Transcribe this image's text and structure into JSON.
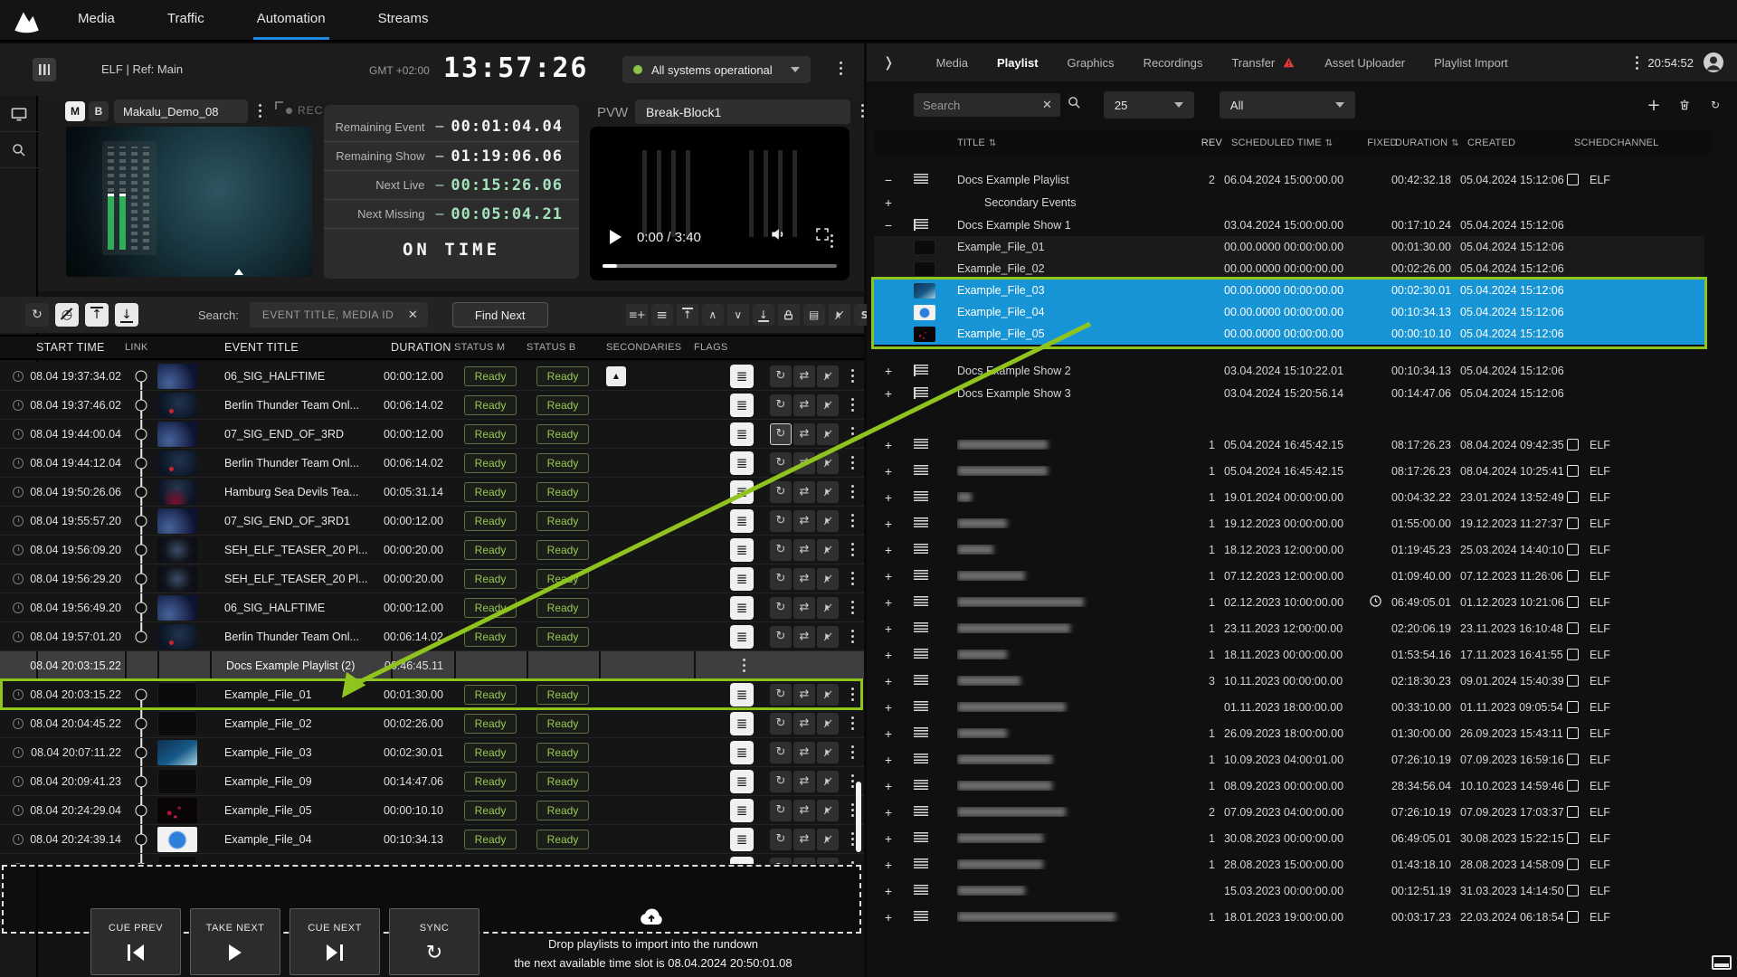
{
  "top_nav": {
    "tabs": [
      "Media",
      "Traffic",
      "Automation",
      "Streams"
    ],
    "active_tab": "Automation"
  },
  "automation": {
    "window_title": "ELF | Ref: Main",
    "gmt": "GMT +02:00",
    "clock": "13:57:26",
    "status": "All systems operational",
    "bus_a": "M",
    "bus_b": "B",
    "channel": "Makalu_Demo_08",
    "rec": "REC",
    "countdowns": [
      {
        "label": "Remaining Event",
        "dash": "–",
        "value": "00:01:04.04",
        "green": false
      },
      {
        "label": "Remaining Show",
        "dash": "–",
        "value": "01:19:06.06",
        "green": false
      },
      {
        "label": "Next Live",
        "dash": "–",
        "value": "00:15:26.06",
        "green": true
      },
      {
        "label": "Next Missing",
        "dash": "–",
        "value": "00:05:04.21",
        "green": true
      }
    ],
    "on_time": "ON TIME",
    "pvw_label": "PVW",
    "pvw_value": "Break-Block1",
    "player_time": "0:00 / 3:40",
    "search_label": "Search:",
    "search_placeholder": "EVENT TITLE, MEDIA ID",
    "find_next": "Find Next",
    "columns": {
      "start": "START TIME",
      "link": "LINK",
      "title": "EVENT TITLE",
      "dur": "DURATION",
      "m": "STATUS M",
      "b": "STATUS B",
      "sec": "SECONDARIES",
      "flags": "FLAGS"
    },
    "rows": [
      {
        "start": "08.04 19:37:34.02",
        "title": "06_SIG_HALFTIME",
        "dur": "00:00:12.00",
        "m": "Ready",
        "b": "Ready",
        "thumb": "planet",
        "link": "start",
        "sec": true
      },
      {
        "start": "08.04 19:37:46.02",
        "title": "Berlin Thunder Team Onl...",
        "dur": "00:06:14.02",
        "m": "Ready",
        "b": "Ready",
        "thumb": "thunder",
        "link": "mid"
      },
      {
        "start": "08.04 19:44:00.04",
        "title": "07_SIG_END_OF_3RD",
        "dur": "00:00:12.00",
        "m": "Ready",
        "b": "Ready",
        "thumb": "planet",
        "link": "mid",
        "flag1": true
      },
      {
        "start": "08.04 19:44:12.04",
        "title": "Berlin Thunder Team Onl...",
        "dur": "00:06:14.02",
        "m": "Ready",
        "b": "Ready",
        "thumb": "thunder",
        "link": "mid"
      },
      {
        "start": "08.04 19:50:26.06",
        "title": "Hamburg Sea Devils Tea...",
        "dur": "00:05:31.14",
        "m": "Ready",
        "b": "Ready",
        "thumb": "devils",
        "link": "mid"
      },
      {
        "start": "08.04 19:55:57.20",
        "title": "07_SIG_END_OF_3RD1",
        "dur": "00:00:12.00",
        "m": "Ready",
        "b": "Ready",
        "thumb": "planet",
        "link": "mid"
      },
      {
        "start": "08.04 19:56:09.20",
        "title": "SEH_ELF_TEASER_20 Pl...",
        "dur": "00:00:20.00",
        "m": "Ready",
        "b": "Ready",
        "thumb": "teaser",
        "link": "mid"
      },
      {
        "start": "08.04 19:56:29.20",
        "title": "SEH_ELF_TEASER_20 Pl...",
        "dur": "00:00:20.00",
        "m": "Ready",
        "b": "Ready",
        "thumb": "teaser",
        "link": "mid"
      },
      {
        "start": "08.04 19:56:49.20",
        "title": "06_SIG_HALFTIME",
        "dur": "00:00:12.00",
        "m": "Ready",
        "b": "Ready",
        "thumb": "planet",
        "link": "mid"
      },
      {
        "start": "08.04 19:57:01.20",
        "title": "Berlin Thunder Team Onl...",
        "dur": "00:06:14.02",
        "m": "Ready",
        "b": "Ready",
        "thumb": "thunder",
        "link": "end"
      },
      {
        "group": true,
        "start": "08.04 20:03:15.22",
        "title": "Docs Example Playlist (2)",
        "dur": "00:46:45.11",
        "link": "none"
      },
      {
        "start": "08.04 20:03:15.22",
        "title": "Example_File_01",
        "dur": "00:01:30.00",
        "m": "Ready",
        "b": "Ready",
        "thumb": "black",
        "link": "start",
        "outlined": true
      },
      {
        "start": "08.04 20:04:45.22",
        "title": "Example_File_02",
        "dur": "00:02:26.00",
        "m": "Ready",
        "b": "Ready",
        "thumb": "black",
        "link": "mid"
      },
      {
        "start": "08.04 20:07:11.22",
        "title": "Example_File_03",
        "dur": "00:02:30.01",
        "m": "Ready",
        "b": "Ready",
        "thumb": "earth",
        "link": "mid"
      },
      {
        "start": "08.04 20:09:41.23",
        "title": "Example_File_09",
        "dur": "00:14:47.06",
        "m": "Ready",
        "b": "Ready",
        "thumb": "black",
        "link": "mid"
      },
      {
        "start": "08.04 20:24:29.04",
        "title": "Example_File_05",
        "dur": "00:00:10.10",
        "m": "Ready",
        "b": "Ready",
        "thumb": "specks",
        "link": "mid"
      },
      {
        "start": "08.04 20:24:39.14",
        "title": "Example_File_04",
        "dur": "00:10:34.13",
        "m": "Ready",
        "b": "Ready",
        "thumb": "bunny",
        "link": "mid"
      },
      {
        "start": "",
        "title": "",
        "dur": "",
        "m": "",
        "b": "",
        "thumb": "black",
        "link": "mid",
        "partial": true
      }
    ],
    "transport": [
      {
        "label": "CUE PREV",
        "icon": "prev"
      },
      {
        "label": "TAKE NEXT",
        "icon": "play"
      },
      {
        "label": "CUE NEXT",
        "icon": "next"
      },
      {
        "label": "SYNC",
        "icon": "sync"
      }
    ],
    "dropzone": {
      "line1": "Drop playlists to import into the rundown",
      "line2": "the next available time slot is 08.04.2024 20:50:01.08"
    }
  },
  "playlist": {
    "tabs": [
      "Media",
      "Playlist",
      "Graphics",
      "Recordings",
      "Transfer",
      "Asset Uploader",
      "Playlist Import"
    ],
    "active_tab": "Playlist",
    "time": "20:54:52",
    "search_placeholder": "Search",
    "page_size": "25",
    "filter": "All",
    "columns": {
      "title": "TITLE",
      "rev": "REV",
      "sched": "SCHEDULED TIME",
      "fixed": "FIXED",
      "dur": "DURATION",
      "created": "CREATED",
      "channel": "SCHEDCHANNEL"
    },
    "tree": [
      {
        "exp": "−",
        "icon": "playlist",
        "title": "Docs Example Playlist",
        "rev": "2",
        "sched": "06.04.2024 15:00:00.00",
        "dur": "00:42:32.18",
        "created": "05.04.2024 15:12:06",
        "checkbox": true,
        "channel": "ELF"
      },
      {
        "exp": "+",
        "title": "Secondary Events",
        "indent": true
      },
      {
        "exp": "−",
        "icon": "show",
        "title": "Docs Example Show 1",
        "sched": "03.04.2024 15:00:00.00",
        "dur": "00:17:10.24",
        "created": "05.04.2024 15:12:06"
      },
      {
        "thumb": "black",
        "title": "Example_File_01",
        "sched": "00.00.0000 00:00:00.00",
        "dur": "00:01:30.00",
        "created": "05.04.2024 15:12:06",
        "child": true
      },
      {
        "thumb": "black",
        "title": "Example_File_02",
        "sched": "00.00.0000 00:00:00.00",
        "dur": "00:02:26.00",
        "created": "05.04.2024 15:12:06",
        "child": true
      },
      {
        "thumb": "earth",
        "title": "Example_File_03",
        "sched": "00.00.0000 00:00:00.00",
        "dur": "00:02:30.01",
        "created": "05.04.2024 15:12:06",
        "child": true,
        "selected": true
      },
      {
        "thumb": "bunny",
        "title": "Example_File_04",
        "sched": "00.00.0000 00:00:00.00",
        "dur": "00:10:34.13",
        "created": "05.04.2024 15:12:06",
        "child": true,
        "selected": true
      },
      {
        "thumb": "specks",
        "title": "Example_File_05",
        "sched": "00.00.0000 00:00:00.00",
        "dur": "00:00:10.10",
        "created": "05.04.2024 15:12:06",
        "child": true,
        "selected": true
      },
      {
        "exp": "+",
        "icon": "show",
        "title": "Docs Example Show 2",
        "sched": "03.04.2024 15:10:22.01",
        "dur": "00:10:34.13",
        "created": "05.04.2024 15:12:06",
        "gap": true
      },
      {
        "exp": "+",
        "icon": "show",
        "title": "Docs Example Show 3",
        "sched": "03.04.2024 15:20:56.14",
        "dur": "00:14:47.06",
        "created": "05.04.2024 15:12:06"
      }
    ],
    "list": [
      {
        "blur_w": 100,
        "rev": "1",
        "sched": "05.04.2024 16:45:42.15",
        "dur": "08:17:26.23",
        "created": "08.04.2024 09:42:35",
        "checkbox": true,
        "channel": "ELF"
      },
      {
        "blur_w": 100,
        "rev": "1",
        "sched": "05.04.2024 16:45:42.15",
        "dur": "08:17:26.23",
        "created": "08.04.2024 10:25:41",
        "checkbox": true,
        "channel": "ELF"
      },
      {
        "blur_w": 16,
        "rev": "1",
        "sched": "19.01.2024 00:00:00.00",
        "dur": "00:04:32.22",
        "created": "23.01.2024 13:52:49",
        "checkbox": true,
        "channel": "ELF"
      },
      {
        "blur_w": 55,
        "rev": "1",
        "sched": "19.12.2023 00:00:00.00",
        "dur": "01:55:00.00",
        "created": "19.12.2023 11:27:37",
        "checkbox": true,
        "channel": "ELF"
      },
      {
        "blur_w": 40,
        "rev": "1",
        "sched": "18.12.2023 12:00:00.00",
        "dur": "01:19:45.23",
        "created": "25.03.2024 14:40:10",
        "checkbox": true,
        "channel": "ELF"
      },
      {
        "blur_w": 75,
        "rev": "1",
        "sched": "07.12.2023 12:00:00.00",
        "dur": "01:09:40.00",
        "created": "07.12.2023 11:26:06",
        "checkbox": true,
        "channel": "ELF"
      },
      {
        "blur_w": 140,
        "rev": "1",
        "sched": "02.12.2023 10:00:00.00",
        "dur": "06:49:05.01",
        "created": "01.12.2023 10:21:06",
        "checkbox": true,
        "channel": "ELF",
        "clock": true
      },
      {
        "blur_w": 125,
        "rev": "1",
        "sched": "23.11.2023 12:00:00.00",
        "dur": "02:20:06.19",
        "created": "23.11.2023 16:10:48",
        "checkbox": true,
        "channel": "ELF"
      },
      {
        "blur_w": 55,
        "rev": "1",
        "sched": "18.11.2023 00:00:00.00",
        "dur": "01:53:54.16",
        "created": "17.11.2023 16:41:55",
        "checkbox": true,
        "channel": "ELF"
      },
      {
        "blur_w": 70,
        "rev": "3",
        "sched": "10.11.2023 00:00:00.00",
        "dur": "02:18:30.23",
        "created": "09.01.2024 15:40:39",
        "checkbox": true,
        "channel": "ELF"
      },
      {
        "blur_w": 120,
        "rev": "",
        "sched": "01.11.2023 18:00:00.00",
        "dur": "00:33:10.00",
        "created": "01.11.2023 09:05:54",
        "checkbox": true,
        "channel": "ELF"
      },
      {
        "blur_w": 55,
        "rev": "1",
        "sched": "26.09.2023 18:00:00.00",
        "dur": "01:30:00.00",
        "created": "26.09.2023 15:43:11",
        "checkbox": true,
        "channel": "ELF"
      },
      {
        "blur_w": 105,
        "rev": "1",
        "sched": "10.09.2023 04:00:01.00",
        "dur": "07:26:10.19",
        "created": "07.09.2023 16:59:16",
        "checkbox": true,
        "channel": "ELF"
      },
      {
        "blur_w": 105,
        "rev": "1",
        "sched": "08.09.2023 00:00:00.00",
        "dur": "28:34:56.04",
        "created": "10.10.2023 14:59:46",
        "checkbox": true,
        "channel": "ELF"
      },
      {
        "blur_w": 120,
        "rev": "2",
        "sched": "07.09.2023 04:00:00.00",
        "dur": "07:26:10.19",
        "created": "07.09.2023 17:03:37",
        "checkbox": true,
        "channel": "ELF"
      },
      {
        "blur_w": 95,
        "rev": "1",
        "sched": "30.08.2023 00:00:00.00",
        "dur": "06:49:05.01",
        "created": "30.08.2023 15:22:15",
        "checkbox": true,
        "channel": "ELF"
      },
      {
        "blur_w": 95,
        "rev": "1",
        "sched": "28.08.2023 15:00:00.00",
        "dur": "01:43:18.10",
        "created": "28.08.2023 14:58:09",
        "checkbox": true,
        "channel": "ELF"
      },
      {
        "blur_w": 75,
        "rev": "",
        "sched": "15.03.2023 00:00:00.00",
        "dur": "00:12:51.19",
        "created": "31.03.2023 14:14:50",
        "checkbox": true,
        "channel": "ELF"
      },
      {
        "blur_w": 175,
        "rev": "1",
        "sched": "18.01.2023 19:00:00.00",
        "dur": "00:03:17.23",
        "created": "22.03.2024 06:18:54",
        "checkbox": true,
        "channel": "ELF"
      }
    ]
  }
}
